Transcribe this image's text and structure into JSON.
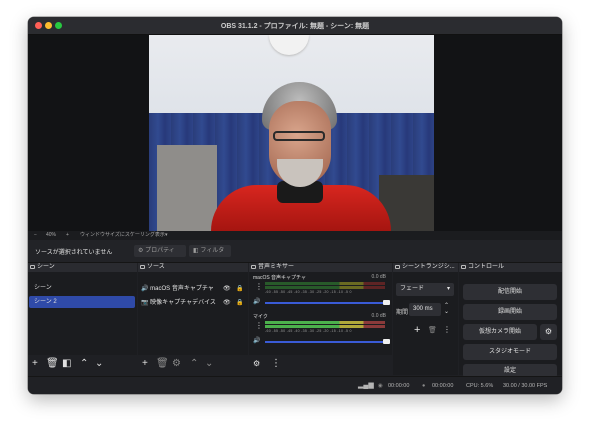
{
  "window": {
    "title": "OBS 31.1.2 - プロファイル: 無題 - シーン: 無題"
  },
  "preview_bar": {
    "zoom_minus": "−",
    "zoom": "40%",
    "zoom_plus": "+",
    "scale_mode": "ウィンドウサイズにスケーリング表示"
  },
  "toolbar": {
    "no_source": "ソースが選択されていません",
    "properties": "プロパティ",
    "filters": "フィルタ"
  },
  "scenes": {
    "title": "シーン",
    "items": [
      {
        "label": "シーン",
        "selected": false
      },
      {
        "label": "シーン 2",
        "selected": true
      }
    ]
  },
  "sources": {
    "title": "ソース",
    "items": [
      {
        "label": "macOS 音声キャプチャ",
        "icon": "speaker-icon"
      },
      {
        "label": "映像キャプチャデバイス",
        "icon": "camera-icon"
      }
    ]
  },
  "mixer": {
    "title": "音声ミキサー",
    "channels": [
      {
        "name": "macOS 音声キャプチャ",
        "db": "0.0 dB",
        "level": 0
      },
      {
        "name": "マイク",
        "db": "0.0 dB",
        "level": 0.62
      }
    ],
    "scale": "-60 -55 -50 -45 -40 -35 -30 -25 -20 -15 -10 -5 0"
  },
  "transitions": {
    "title": "シーントランジシ...",
    "type": "フェード",
    "duration_label": "期間",
    "duration": "300 ms"
  },
  "controls": {
    "title": "コントロール",
    "buttons": [
      "配信開始",
      "録画開始",
      "仮想カメラ開始",
      "スタジオモード",
      "設定"
    ]
  },
  "status": {
    "stream_time": "00:00:00",
    "record_time": "00:00:00",
    "cpu": "CPU: 5.6%",
    "fps": "30.00 / 30.00 FPS"
  },
  "colors": {
    "accent": "#2f4aa8",
    "panel": "#1b1c1f",
    "header": "#2a2b30"
  }
}
